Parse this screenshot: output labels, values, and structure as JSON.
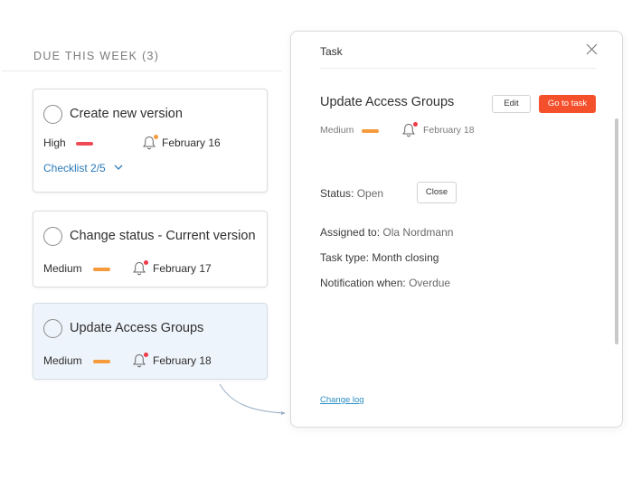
{
  "section": {
    "title": "DUE THIS WEEK (3)"
  },
  "colors": {
    "high": "#ef4b54",
    "medium": "#f59b3d",
    "dot_orange": "#f59b3d",
    "dot_red": "#ef3a4a",
    "accent": "#f4502c",
    "link": "#2c8fc4"
  },
  "tasks": [
    {
      "title": "Create new version",
      "priority": "High",
      "due": "February 16",
      "checklist": "Checklist 2/5",
      "icon": "bell-icon"
    },
    {
      "title": "Change status - Current version",
      "priority": "Medium",
      "due": "February 17",
      "icon": "bell-icon"
    },
    {
      "title": "Update Access Groups",
      "priority": "Medium",
      "due": "February 18",
      "icon": "bell-icon",
      "selected": true
    }
  ],
  "panel": {
    "header": "Task",
    "close_icon": "close-icon",
    "title": "Update Access Groups",
    "edit_label": "Edit",
    "go_label": "Go to task",
    "priority": "Medium",
    "due": "February 18",
    "status_label": "Status:",
    "status_value": "Open",
    "close_button_label": "Close",
    "assigned_label": "Assigned to:",
    "assigned_value": "Ola Nordmann",
    "type_label": "Task type:",
    "type_value": "Month closing",
    "notification_label": "Notification when:",
    "notification_value": "Overdue",
    "change_log": "Change log"
  }
}
